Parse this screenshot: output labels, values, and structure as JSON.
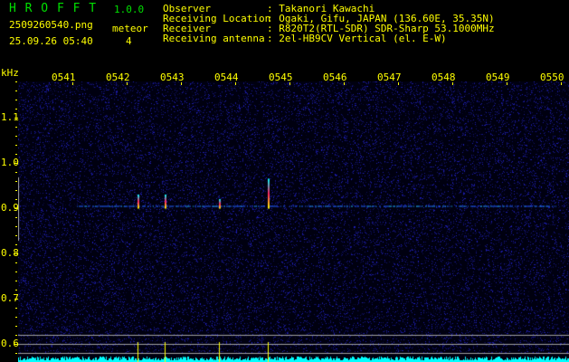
{
  "header": {
    "app_name": "H R O F F T",
    "version": "1.0.0",
    "filename": "2509260540.png",
    "datetime": "25.09.26 05:40",
    "meteor_label": "meteor",
    "meteor_count": "4",
    "info": [
      {
        "label": "Observer",
        "value": ": Takanori Kawachi"
      },
      {
        "label": "Receiving Location",
        "value": ": Ogaki, Gifu, JAPAN (136.60E, 35.35N)"
      },
      {
        "label": "Receiver",
        "value": ": R820T2(RTL-SDR) SDR-Sharp 53.1000MHz"
      },
      {
        "label": "Receiving antenna",
        "value": ": 2el-HB9CV Vertical (el. E-W)"
      }
    ]
  },
  "colors": {
    "text": "#ffff00",
    "title": "#00e000",
    "background": "#000000",
    "noise": "#1010a0",
    "histogram": "#00ffff",
    "guide_lines": "#a0a0a0"
  },
  "chart_data": {
    "type": "heatmap",
    "ylabel": "kHz",
    "x_ticks": [
      "0541",
      "0542",
      "0543",
      "0544",
      "0545",
      "0546",
      "0547",
      "0548",
      "0549",
      "0550"
    ],
    "x_range": [
      "05:40",
      "05:50"
    ],
    "y_ticks": [
      "1.1",
      "1.0",
      "0.9",
      "0.8",
      "0.7",
      "0.6"
    ],
    "y_range": [
      0.58,
      1.2
    ],
    "carrier_khz": 0.905,
    "meteors": [
      {
        "time": "05:42.2",
        "khz_top": 0.93
      },
      {
        "time": "05:42.7",
        "khz_top": 0.93
      },
      {
        "time": "05:43.7",
        "khz_top": 0.92
      },
      {
        "time": "05:44.6",
        "khz_top": 0.965
      }
    ]
  }
}
